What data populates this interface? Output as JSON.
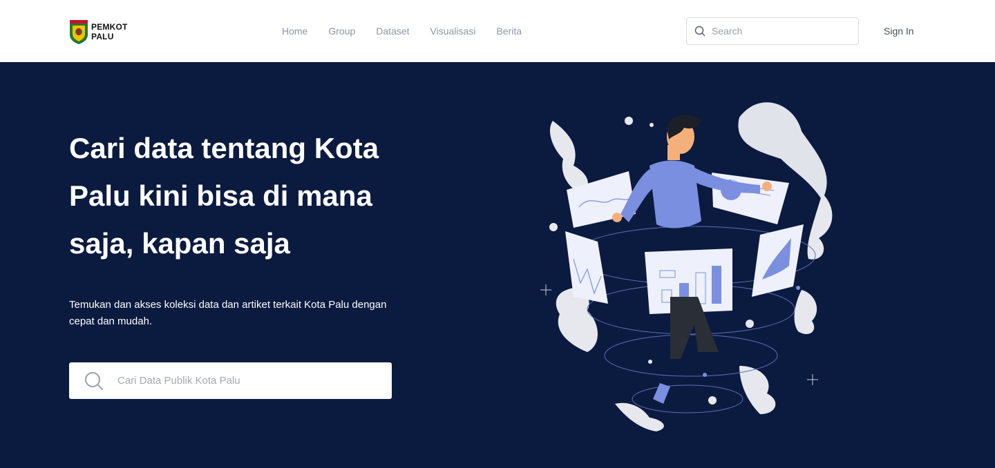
{
  "header": {
    "logo_text_line1": "PEMKOT",
    "logo_text_line2": "PALU",
    "nav": [
      {
        "label": "Home"
      },
      {
        "label": "Group"
      },
      {
        "label": "Dataset"
      },
      {
        "label": "Visualisasi"
      },
      {
        "label": "Berita"
      }
    ],
    "search_placeholder": "Search",
    "signin_label": "Sign In"
  },
  "hero": {
    "title_line1": "Cari data tentang Kota",
    "title_line2": "Palu kini bisa di mana",
    "title_line3": "saja, kapan saja",
    "subtitle": "Temukan dan akses koleksi data dan artiket  terkait Kota Palu dengan cepat dan mudah.",
    "search_placeholder": "Cari Data Publik Kota Palu"
  },
  "colors": {
    "hero_bg": "#0b1a3f",
    "header_bg": "#ffffff",
    "accent": "#7b8fe0"
  },
  "icons": [
    "logo-emblem",
    "search-icon",
    "search-icon-large",
    "person-with-charts-illustration"
  ]
}
